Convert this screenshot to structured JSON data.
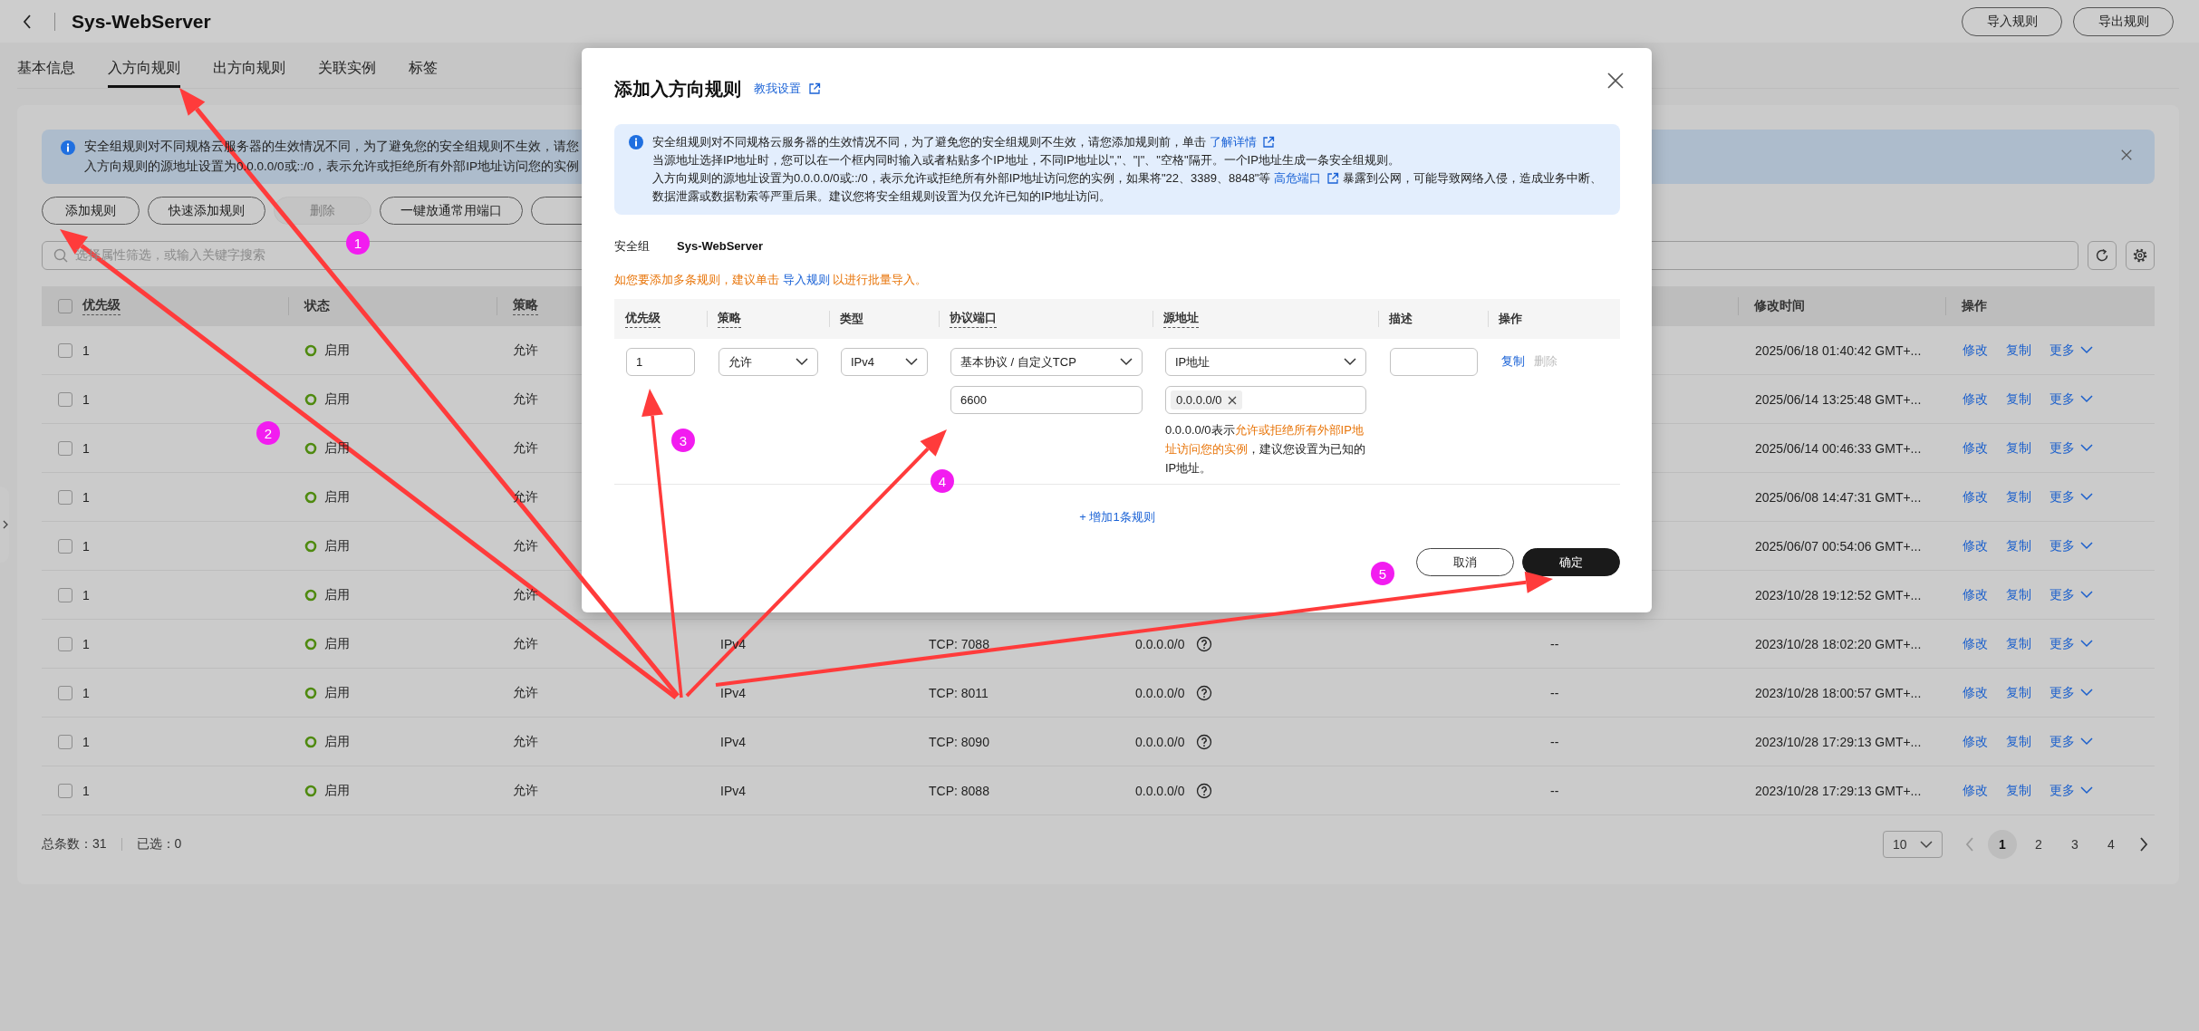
{
  "header": {
    "title": "Sys-WebServer",
    "buttons": [
      "导入规则",
      "导出规则"
    ]
  },
  "tabs": [
    {
      "label": "基本信息",
      "selected": false
    },
    {
      "label": "入方向规则",
      "selected": true
    },
    {
      "label": "出方向规则",
      "selected": false
    },
    {
      "label": "关联实例",
      "selected": false
    },
    {
      "label": "标签",
      "selected": false
    }
  ],
  "notice": {
    "lines": [
      "安全组规则对不同规格云服务器的生效情况不同，为了避免您的安全组规则不生效，请您",
      "入方向规则的源地址设置为0.0.0.0/0或::/0，表示允许或拒绝所有外部IP地址访问您的实例"
    ]
  },
  "toolbar": [
    {
      "label": "添加规则",
      "disabled": false
    },
    {
      "label": "快速添加规则",
      "disabled": false
    },
    {
      "label": "删除",
      "disabled": true
    },
    {
      "label": "一键放通常用端口",
      "disabled": false
    },
    {
      "disabled": false
    }
  ],
  "search": {
    "placeholder": "选择属性筛选，或输入关键字搜索"
  },
  "table": {
    "select_all_checked": false,
    "columns": [
      {
        "label": "优先级",
        "tooltip": true
      },
      {
        "label": "状态",
        "tooltip": false
      },
      {
        "label": "策略",
        "tooltip": true
      },
      {
        "label": "修改时间",
        "tooltip": false
      },
      {
        "label": "操作",
        "tooltip": false
      }
    ],
    "rows": [
      {
        "checked": false,
        "priority": "1",
        "status": "启用",
        "policy": "允许",
        "modified": "2025/06/18 01:40:42 GMT+...",
        "actions": [
          "修改",
          "复制",
          "更多"
        ]
      },
      {
        "checked": false,
        "priority": "1",
        "status": "启用",
        "policy": "允许",
        "modified": "2025/06/14 13:25:48 GMT+...",
        "actions": [
          "修改",
          "复制",
          "更多"
        ]
      },
      {
        "checked": false,
        "priority": "1",
        "status": "启用",
        "policy": "允许",
        "modified": "2025/06/14 00:46:33 GMT+...",
        "actions": [
          "修改",
          "复制",
          "更多"
        ]
      },
      {
        "checked": false,
        "priority": "1",
        "status": "启用",
        "policy": "允许",
        "modified": "2025/06/08 14:47:31 GMT+...",
        "actions": [
          "修改",
          "复制",
          "更多"
        ]
      },
      {
        "checked": false,
        "priority": "1",
        "status": "启用",
        "policy": "允许",
        "modified": "2025/06/07 00:54:06 GMT+...",
        "actions": [
          "修改",
          "复制",
          "更多"
        ]
      },
      {
        "checked": false,
        "priority": "1",
        "status": "启用",
        "policy": "允许",
        "modified": "2023/10/28 19:12:52 GMT+...",
        "actions": [
          "修改",
          "复制",
          "更多"
        ]
      },
      {
        "checked": false,
        "priority": "1",
        "status": "启用",
        "policy": "允许",
        "type": "IPv4",
        "port": "TCP: 7088",
        "source": "0.0.0.0/0",
        "description": "--",
        "modified": "2023/10/28 18:02:20 GMT+...",
        "actions": [
          "修改",
          "复制",
          "更多"
        ]
      },
      {
        "checked": false,
        "priority": "1",
        "status": "启用",
        "policy": "允许",
        "type": "IPv4",
        "port": "TCP: 8011",
        "source": "0.0.0.0/0",
        "description": "--",
        "modified": "2023/10/28 18:00:57 GMT+...",
        "actions": [
          "修改",
          "复制",
          "更多"
        ]
      },
      {
        "checked": false,
        "priority": "1",
        "status": "启用",
        "policy": "允许",
        "type": "IPv4",
        "port": "TCP: 8090",
        "source": "0.0.0.0/0",
        "description": "--",
        "modified": "2023/10/28 17:29:13 GMT+...",
        "actions": [
          "修改",
          "复制",
          "更多"
        ]
      },
      {
        "checked": false,
        "priority": "1",
        "status": "启用",
        "policy": "允许",
        "type": "IPv4",
        "port": "TCP: 8088",
        "source": "0.0.0.0/0",
        "description": "--",
        "modified": "2023/10/28 17:29:13 GMT+...",
        "actions": [
          "修改",
          "复制",
          "更多"
        ]
      }
    ]
  },
  "footer": {
    "total": "总条数：31",
    "selected": "已选：0"
  },
  "pagination": {
    "page_size": "10",
    "prev_disabled": true,
    "next_disabled": false,
    "pages": [
      {
        "label": "1",
        "selected": true
      },
      {
        "label": "2",
        "selected": false
      },
      {
        "label": "3",
        "selected": false
      },
      {
        "label": "4",
        "selected": false
      }
    ]
  },
  "dialog": {
    "title": "添加入方向规则",
    "help_link": "教我设置",
    "notice": [
      [
        {
          "kind": "text",
          "text": "安全组规则对不同规格云服务器的生效情况不同，为了避免您的安全组规则不生效，请您添加规则前，单击 "
        },
        {
          "kind": "link",
          "text": "了解详情"
        }
      ],
      [
        {
          "kind": "text",
          "text": "当源地址选择IP地址时，您可以在一个框内同时输入或者粘贴多个IP地址，不同IP地址以\",\"、\"|\"、\"空格\"隔开。一个IP地址生成一条安全组规则。"
        }
      ],
      [
        {
          "kind": "text",
          "text": "入方向规则的源地址设置为0.0.0.0/0或::/0，表示允许或拒绝所有外部IP地址访问您的实例，如果将\"22、3389、8848\"等 "
        },
        {
          "kind": "link",
          "text": "高危端口"
        },
        {
          "kind": "text",
          "text": " 暴露到公网，可能导致网络入侵，造成业务中断、数据泄露或数据勒索等严重后果。建议您将安全组规则设置为仅允许已知的IP地址访问。"
        }
      ]
    ],
    "group_label": "安全组",
    "group_name": "Sys-WebServer",
    "tip": [
      {
        "kind": "text",
        "text": "如您要添加多条规则，建议单击 "
      },
      {
        "kind": "link",
        "text": "导入规则"
      },
      {
        "kind": "text",
        "text": " 以进行批量导入。"
      }
    ],
    "columns": [
      {
        "label": "优先级",
        "tooltip": true
      },
      {
        "label": "策略",
        "tooltip": true
      },
      {
        "label": "类型",
        "tooltip": false
      },
      {
        "label": "协议端口",
        "tooltip": true
      },
      {
        "label": "源地址",
        "tooltip": true
      },
      {
        "label": "描述",
        "tooltip": false
      },
      {
        "label": "操作",
        "tooltip": false
      }
    ],
    "rule": {
      "priority": "1",
      "policy": "允许",
      "type": "IPv4",
      "protocol": "基本协议 / 自定义TCP",
      "port": "6600",
      "source_type": "IP地址",
      "source_tags": [
        "0.0.0.0/0"
      ],
      "source_hint": [
        {
          "kind": "text",
          "text": "0.0.0.0/0表示"
        },
        {
          "kind": "highlight",
          "text": "允许或拒绝所有外部IP地址访问您的实例"
        },
        {
          "kind": "text",
          "text": "，建议您设置为已知的IP地址。"
        }
      ],
      "actions": [
        {
          "label": "复制",
          "disabled": false
        },
        {
          "label": "删除",
          "disabled": true
        }
      ]
    },
    "add_rule": "+ 增加1条规则",
    "buttons": [
      {
        "label": "取消",
        "primary": false
      },
      {
        "label": "确定",
        "primary": true
      }
    ]
  },
  "annotations": [
    {
      "label": "1"
    },
    {
      "label": "2"
    },
    {
      "label": "3"
    },
    {
      "label": "4"
    },
    {
      "label": "5"
    }
  ]
}
